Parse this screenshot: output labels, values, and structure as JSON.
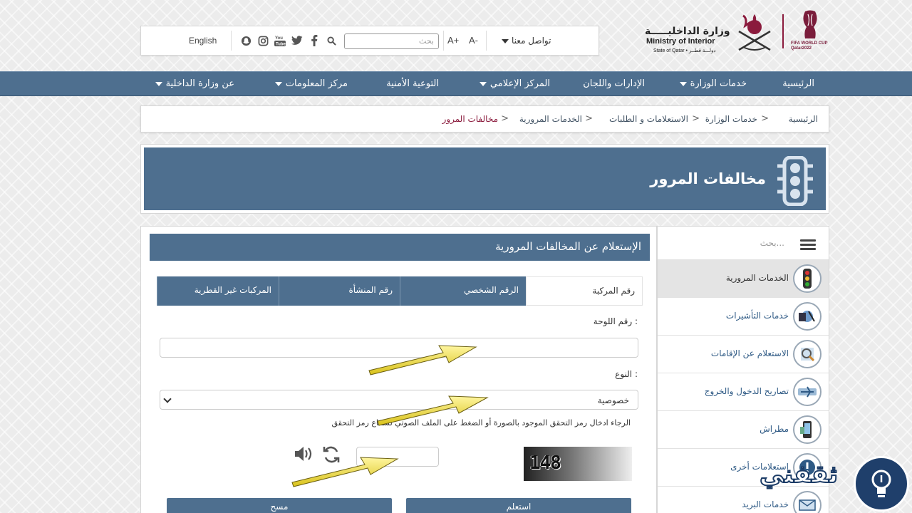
{
  "header": {
    "language_link": "English",
    "search_placeholder": "بحث",
    "font_decrease": "A-",
    "font_increase": "A+",
    "contact": "تواصل معنا",
    "social_icons": [
      "snapchat-icon",
      "instagram-icon",
      "youtube-icon",
      "twitter-icon",
      "facebook-icon"
    ],
    "logo": {
      "ministry_ar": "وزارة الداخليـــــة",
      "ministry_en": "Ministry of Interior",
      "state": "State of Qatar • دولـــة قطــر",
      "fifa": "FIFA WORLD CUP Qatar2022"
    }
  },
  "nav": {
    "items": [
      {
        "label": "الرئيسية",
        "dropdown": false
      },
      {
        "label": "خدمات الوزارة",
        "dropdown": true
      },
      {
        "label": "الإدارات واللجان",
        "dropdown": false
      },
      {
        "label": "المركز الإعلامي",
        "dropdown": true
      },
      {
        "label": "التوعية الأمنية",
        "dropdown": false
      },
      {
        "label": "مركز المعلومات",
        "dropdown": true
      },
      {
        "label": "عن وزارة الداخلية",
        "dropdown": true
      }
    ]
  },
  "breadcrumb": [
    "الرئيسية",
    "خدمات الوزارة",
    "الاستعلامات و الطلبات",
    "الخدمات المرورية",
    "مخالفات المرور"
  ],
  "banner": {
    "title": "مخالفات المرور",
    "icon": "traffic-light-icon"
  },
  "form": {
    "title": "الإستعلام عن المخالفات المرورية",
    "tabs": [
      "رقم المركبة",
      "الرقم الشخصي",
      "رقم المنشأة",
      "المركبات غير القطرية"
    ],
    "active_tab": "رقم المركبة",
    "plate_label": "رقم اللوحة :",
    "plate_value": "",
    "type_label": "النوع :",
    "type_value": "خصوصية",
    "captcha_hint": "الرجاء ادخال رمز التحقق الموجود بالصورة أو الضغط على الملف الصوتي لسماع رمز التحقق",
    "captcha_code": "148",
    "captcha_value": "",
    "submit_label": "استعلم",
    "clear_label": "مسح"
  },
  "sidebar": {
    "search_placeholder": "بحث...",
    "items": [
      {
        "label": "الخدمات المرورية",
        "icon": "traffic-light-icon",
        "active": true
      },
      {
        "label": "خدمات التأشيرات",
        "icon": "passport-icon",
        "active": false
      },
      {
        "label": "الاستعلام عن الإقامات",
        "icon": "residency-icon",
        "active": false
      },
      {
        "label": "تصاريح الدخول والخروج",
        "icon": "airplane-icon",
        "active": false
      },
      {
        "label": "مطراش",
        "icon": "phone-icon",
        "active": false
      },
      {
        "label": "استعلامات أخرى",
        "icon": "info-icon",
        "active": false
      },
      {
        "label": "خدمات البريد",
        "icon": "mail-icon",
        "active": false
      }
    ]
  },
  "watermark": {
    "text": "ثقفني"
  },
  "colors": {
    "primary": "#4e6f8f",
    "accent": "#8b1b3d",
    "arrow": "#f2e23a"
  }
}
